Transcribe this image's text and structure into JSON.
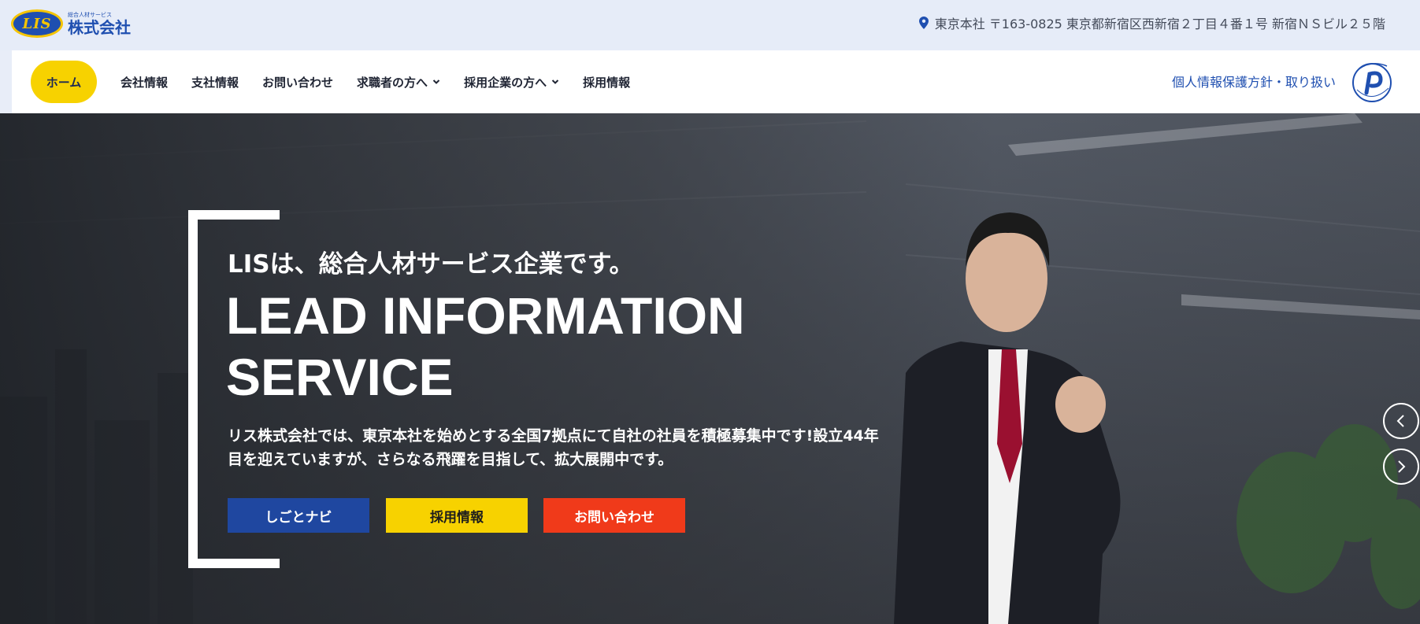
{
  "header": {
    "logo_mark": "LIS",
    "logo_small": "総合人材サービス",
    "logo_name": "株式会社",
    "address": "東京本社 〒163-0825 東京都新宿区西新宿２丁目４番１号 新宿ＮＳビル２５階",
    "pin_icon": "map-pin-icon"
  },
  "nav": {
    "home": "ホーム",
    "items": [
      {
        "label": "会社情報",
        "dropdown": false
      },
      {
        "label": "支社情報",
        "dropdown": false
      },
      {
        "label": "お問い合わせ",
        "dropdown": false
      },
      {
        "label": "求職者の方へ",
        "dropdown": true
      },
      {
        "label": "採用企業の方へ",
        "dropdown": true
      },
      {
        "label": "採用情報",
        "dropdown": false
      }
    ],
    "privacy": "個人情報保護方針・取り扱い",
    "pmark_icon": "privacy-mark-icon"
  },
  "hero": {
    "tagline": "LISは、総合人材サービス企業です。",
    "headline_line1": "LEAD INFORMATION",
    "headline_line2": "SERVICE",
    "description": "リス株式会社では、東京本社を始めとする全国7拠点にて自社の社員を積極募集中です!設立44年目を迎えていますが、さらなる飛躍を目指して、拡大展開中です。",
    "buttons": {
      "primary": "しごとナビ",
      "secondary": "採用情報",
      "tertiary": "お問い合わせ"
    },
    "colors": {
      "primary": "#1f47a0",
      "secondary": "#f7d200",
      "tertiary": "#f03a1a"
    }
  }
}
